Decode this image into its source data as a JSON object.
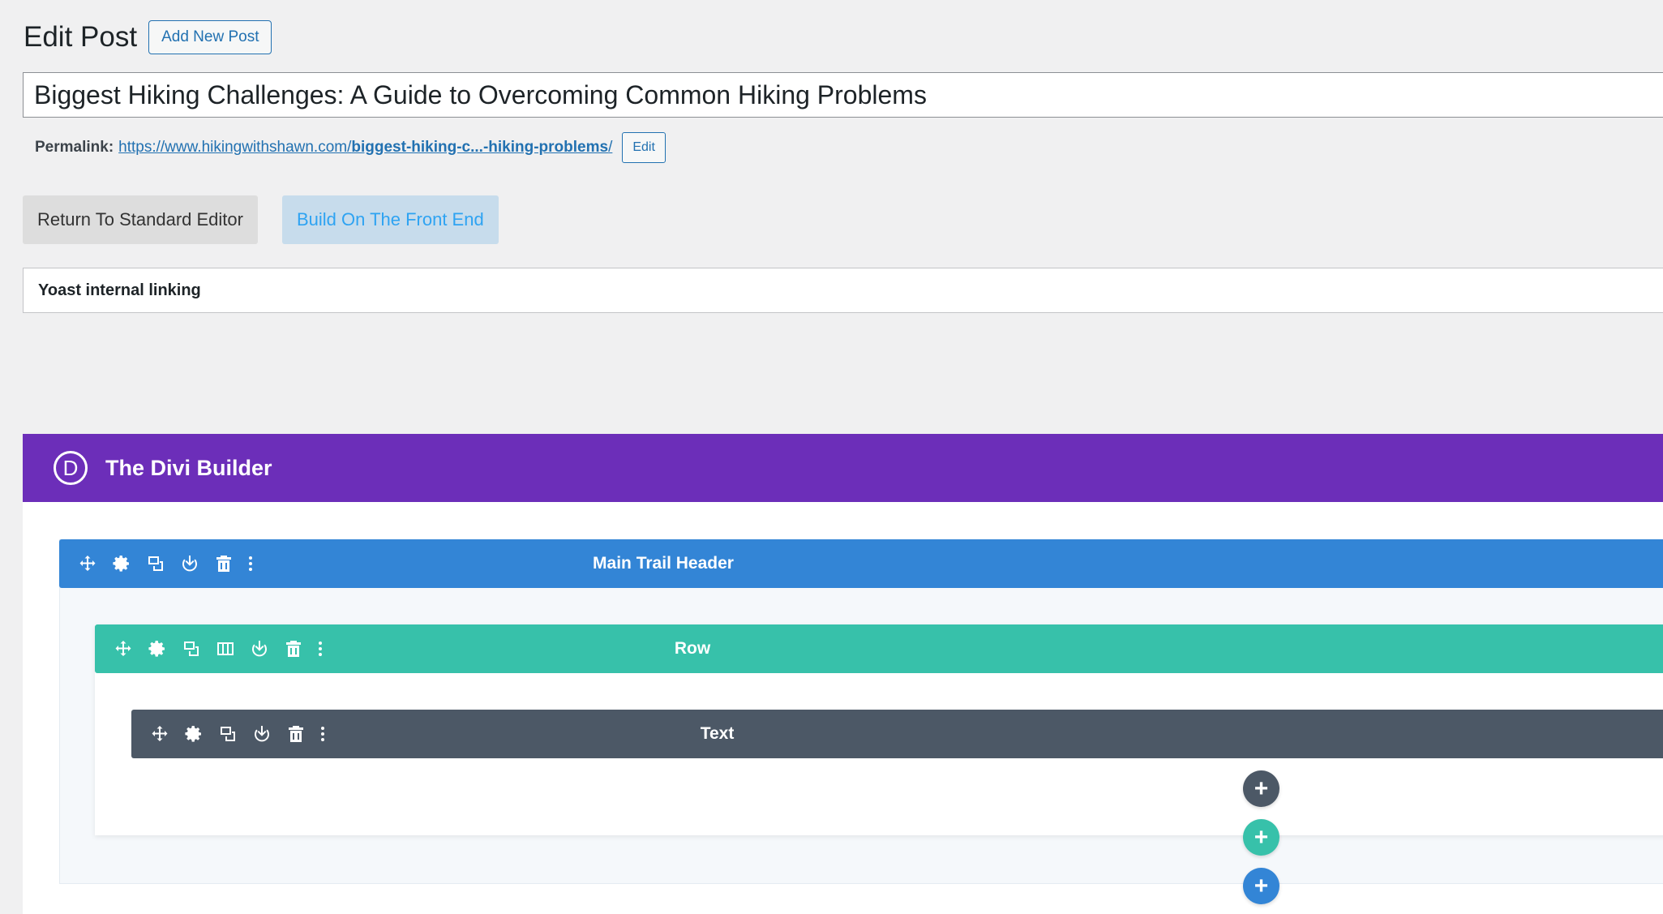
{
  "header": {
    "title": "Edit Post",
    "add_new_label": "Add New Post"
  },
  "post": {
    "title_value": "Biggest Hiking Challenges: A Guide to Overcoming Common Hiking Problems",
    "permalink_label": "Permalink:",
    "permalink_base": "https://www.hikingwithshawn.com/",
    "permalink_slug": "biggest-hiking-c...-hiking-problems",
    "permalink_trailing": "/",
    "permalink_edit_label": "Edit"
  },
  "editor_buttons": {
    "standard_label": "Return To Standard Editor",
    "front_end_label": "Build On The Front End"
  },
  "yoast": {
    "title": "Yoast internal linking"
  },
  "divi": {
    "logo_letter": "D",
    "title": "The Divi Builder",
    "section_label": "Main Trail Header",
    "row_label": "Row",
    "module_label": "Text",
    "plus_symbol": "+",
    "colors": {
      "header": "#6c2eb9",
      "section": "#3385d6",
      "row": "#37c1aa",
      "module": "#4c5866"
    },
    "section_tools": [
      "move-icon",
      "gear-icon",
      "duplicate-icon",
      "save-icon",
      "trash-icon",
      "more-icon"
    ],
    "row_tools": [
      "move-icon",
      "gear-icon",
      "duplicate-icon",
      "columns-icon",
      "save-icon",
      "trash-icon",
      "more-icon"
    ],
    "module_tools": [
      "move-icon",
      "gear-icon",
      "duplicate-icon",
      "save-icon",
      "trash-icon",
      "more-icon"
    ]
  }
}
